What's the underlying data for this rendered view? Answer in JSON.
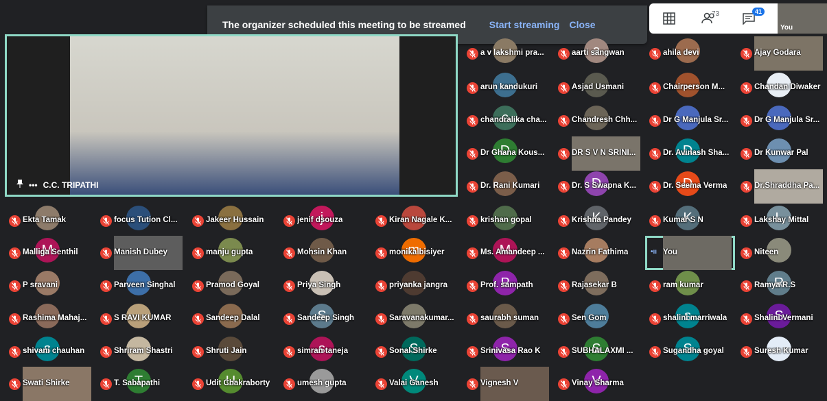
{
  "banner": {
    "message": "The organizer scheduled this meeting to be streamed",
    "start_label": "Start streaming",
    "close_label": "Close"
  },
  "toolbar": {
    "people_count": "73",
    "chat_badge": "41",
    "self_label": "You"
  },
  "main_speaker": {
    "name": "C.C. TRIPATHI"
  },
  "participants": [
    {
      "name": "a v lakshmi pra...",
      "type": "photo",
      "color": "#8a7a64"
    },
    {
      "name": "aarti sangwan",
      "type": "letter",
      "letter": "a",
      "color": "#a1887f"
    },
    {
      "name": "ahila devi",
      "type": "photo",
      "color": "#9c6b4e"
    },
    {
      "name": "Ajay Godara",
      "type": "video",
      "color": "#7d7466"
    },
    {
      "name": "arun kandukuri",
      "type": "photo",
      "color": "#3d6f8f"
    },
    {
      "name": "Asjad Usmani",
      "type": "photo",
      "color": "#5a5a4f"
    },
    {
      "name": "Chairperson M...",
      "type": "photo",
      "color": "#a0522d"
    },
    {
      "name": "Chandan Diwaker",
      "type": "photo",
      "color": "#e8eef5"
    },
    {
      "name": "chandralika cha...",
      "type": "letter",
      "letter": "c",
      "color": "#3c6e5a"
    },
    {
      "name": "Chandresh Chh...",
      "type": "photo",
      "color": "#6b6457"
    },
    {
      "name": "Dr G Manjula Sr...",
      "type": "photo",
      "color": "#4a69bd"
    },
    {
      "name": "Dr G Manjula Sr...",
      "type": "photo",
      "color": "#4a69bd"
    },
    {
      "name": "Dr Ghana Kous...",
      "type": "letter",
      "letter": "D",
      "color": "#2e7d32"
    },
    {
      "name": "DR S V N SRINI...",
      "type": "video",
      "color": "#7a746a"
    },
    {
      "name": "Dr. Avinash Sha...",
      "type": "letter",
      "letter": "D",
      "color": "#00838f"
    },
    {
      "name": "Dr Kunwar Pal",
      "type": "photo",
      "color": "#6d8fb0"
    },
    {
      "name": "Dr. Rani Kumari",
      "type": "photo",
      "color": "#7b5e4a"
    },
    {
      "name": "Dr. S Swapna K...",
      "type": "letter",
      "letter": "D",
      "color": "#8e44ad"
    },
    {
      "name": "Dr. Seema Verma",
      "type": "letter",
      "letter": "D",
      "color": "#e64a19"
    },
    {
      "name": "Dr.Shraddha Pa...",
      "type": "video",
      "color": "#b0aaa0"
    },
    {
      "name": "Ekta Tamak",
      "type": "photo",
      "color": "#8d7b6a"
    },
    {
      "name": "focus Tution Cl...",
      "type": "photo",
      "color": "#2b4f7a"
    },
    {
      "name": "Jakeer Hussain",
      "type": "photo",
      "color": "#8a7040"
    },
    {
      "name": "jenif dsouza",
      "type": "letter",
      "letter": "j",
      "color": "#c2185b"
    },
    {
      "name": "Kiran Nagale K...",
      "type": "photo",
      "color": "#b9473c"
    },
    {
      "name": "krishan gopal",
      "type": "photo",
      "color": "#4f6b4a"
    },
    {
      "name": "Krishna Pandey",
      "type": "letter",
      "letter": "K",
      "color": "#5f6368"
    },
    {
      "name": "Kumar S N",
      "type": "letter",
      "letter": "K",
      "color": "#546e7a"
    },
    {
      "name": "Lakshay Mittal",
      "type": "letter",
      "letter": "L",
      "color": "#78909c"
    },
    {
      "name": "Malliga Senthil",
      "type": "letter",
      "letter": "M",
      "color": "#ad1457"
    },
    {
      "name": "Manish Dubey",
      "type": "video",
      "color": "#5d5d5d"
    },
    {
      "name": "manju gupta",
      "type": "photo",
      "color": "#7b8a4e"
    },
    {
      "name": "Mohsin Khan",
      "type": "photo",
      "color": "#6f5a48"
    },
    {
      "name": "monika bisiyer",
      "type": "letter",
      "letter": "m",
      "color": "#ef6c00"
    },
    {
      "name": "Ms. Amandeep ...",
      "type": "letter",
      "letter": "M",
      "color": "#ad1457"
    },
    {
      "name": "Nazrin Fathima",
      "type": "photo",
      "color": "#a67c60"
    },
    {
      "name": "You",
      "type": "video",
      "color": "#6d6a63"
    },
    {
      "name": "Niteen",
      "type": "photo",
      "color": "#8a8a7a"
    },
    {
      "name": "P sravani",
      "type": "photo",
      "color": "#9a7a66"
    },
    {
      "name": "Parveen Singhal",
      "type": "photo",
      "color": "#3d6fa8"
    },
    {
      "name": "Pramod Goyal",
      "type": "photo",
      "color": "#7a6a5a"
    },
    {
      "name": "Priya Singh",
      "type": "photo",
      "color": "#c9c0b5"
    },
    {
      "name": "priyanka jangra",
      "type": "photo",
      "color": "#4e3b31"
    },
    {
      "name": "Prof. sampath",
      "type": "letter",
      "letter": "P",
      "color": "#8e24aa"
    },
    {
      "name": "Rajasekar B",
      "type": "photo",
      "color": "#7e6d5d"
    },
    {
      "name": "ram kumar",
      "type": "photo",
      "color": "#6f8f4a"
    },
    {
      "name": "Ramya R.S",
      "type": "letter",
      "letter": "R",
      "color": "#607d8b"
    },
    {
      "name": "Rashima Mahaj...",
      "type": "photo",
      "color": "#8a6a5a"
    },
    {
      "name": "S RAVI KUMAR",
      "type": "photo",
      "color": "#b9a07a"
    },
    {
      "name": "Sandeep Dalal",
      "type": "photo",
      "color": "#8a6a4e"
    },
    {
      "name": "Sandeep Singh",
      "type": "letter",
      "letter": "S",
      "color": "#5c7a8c"
    },
    {
      "name": "Saravanakumar...",
      "type": "photo",
      "color": "#7d7a6a"
    },
    {
      "name": "saurabh suman",
      "type": "photo",
      "color": "#6a5a4a"
    },
    {
      "name": "Sen Gom",
      "type": "photo",
      "color": "#4e7d9a"
    },
    {
      "name": "shalini marriwala",
      "type": "letter",
      "letter": "s",
      "color": "#00838f"
    },
    {
      "name": "Shalini Vermani",
      "type": "letter",
      "letter": "S",
      "color": "#6a1b9a"
    },
    {
      "name": "shivani chauhan",
      "type": "letter",
      "letter": "s",
      "color": "#00838f"
    },
    {
      "name": "Shriram Shastri",
      "type": "photo",
      "color": "#c4b7a0"
    },
    {
      "name": "Shruti Jain",
      "type": "photo",
      "color": "#5a4a3a"
    },
    {
      "name": "simran taneja",
      "type": "letter",
      "letter": "s",
      "color": "#ad1457"
    },
    {
      "name": "Sonal Shirke",
      "type": "letter",
      "letter": "S",
      "color": "#00695c"
    },
    {
      "name": "Srinivasa Rao K",
      "type": "letter",
      "letter": "S",
      "color": "#8e24aa"
    },
    {
      "name": "SUBHALAXMI ...",
      "type": "letter",
      "letter": "S",
      "color": "#2e7d32"
    },
    {
      "name": "Sugandha goyal",
      "type": "letter",
      "letter": "S",
      "color": "#00838f"
    },
    {
      "name": "Suresh Kumar",
      "type": "photo",
      "color": "#e3ecf7"
    },
    {
      "name": "Swati Shirke",
      "type": "video",
      "color": "#8a7766"
    },
    {
      "name": "T. Sabapathi",
      "type": "letter",
      "letter": "T",
      "color": "#2e7d32"
    },
    {
      "name": "Udit Chakraborty",
      "type": "letter",
      "letter": "U",
      "color": "#558b2f"
    },
    {
      "name": "umesh gupta",
      "type": "photo",
      "color": "#9a9a9a"
    },
    {
      "name": "Valai Ganesh",
      "type": "letter",
      "letter": "V",
      "color": "#00897b"
    },
    {
      "name": "Vignesh V",
      "type": "video",
      "color": "#6a5a4e"
    },
    {
      "name": "Vinay Sharma",
      "type": "letter",
      "letter": "V",
      "color": "#8e24aa"
    }
  ]
}
